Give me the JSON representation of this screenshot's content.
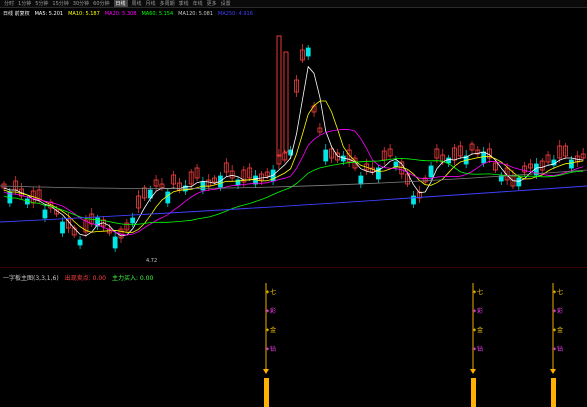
{
  "toolbar": {
    "items": [
      "分时",
      "1分钟",
      "5分钟",
      "15分钟",
      "30分钟",
      "60分钟",
      "日线",
      "周线",
      "月线",
      "多周期",
      "季线",
      "年线",
      "更多",
      "设置"
    ],
    "active_index": 6
  },
  "legend": {
    "title": "日线 前复权",
    "ma5": "MA5: 5.201",
    "ma10": "MA10: 5.187",
    "ma20": "MA20: 5.308",
    "ma60": "MA60: 5.154",
    "ma120": "MA120: 5.081",
    "ma250": "MA250: 4.916"
  },
  "price_low_label": "4.72",
  "sub_legend": {
    "name": "一字板主图(3,3,1,6)",
    "a": "出现卖点: 0.00",
    "b": "主力买入: 0.00"
  },
  "signals": [
    {
      "labels": [
        "七",
        "彩",
        "金",
        "钻"
      ]
    },
    {
      "labels": [
        "七",
        "彩",
        "金",
        "钻"
      ]
    },
    {
      "labels": [
        "七",
        "彩",
        "金",
        "钻"
      ]
    }
  ],
  "colors": {
    "up": "#ff4040",
    "down": "#00e5e5",
    "ma5": "#ffffff",
    "ma10": "#ffff00",
    "ma20": "#ff00ff",
    "ma60": "#00ff00",
    "ma120": "#808080",
    "ma250": "#4040ff",
    "signal_line": "#c89000",
    "signal_bar": "#ffb000"
  }
}
